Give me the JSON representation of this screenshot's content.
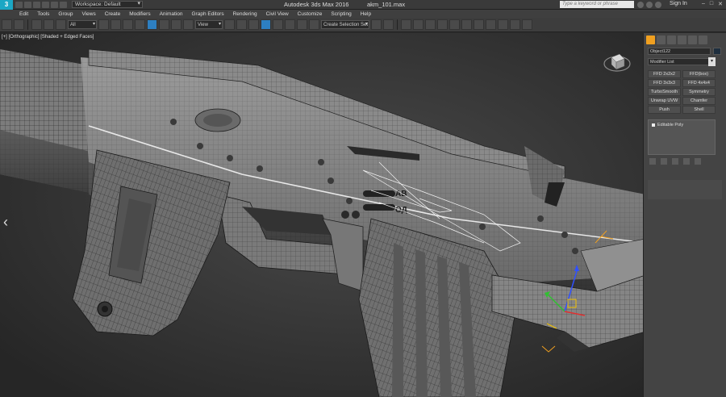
{
  "titlebar": {
    "app_logo": "3",
    "workspace": "Workspace: Default",
    "app_title": "Autodesk 3ds Max 2016",
    "file_name": "akm_101.max",
    "search_placeholder": "Type a keyword or phrase",
    "sign_in": "Sign In"
  },
  "menu": [
    "Edit",
    "Tools",
    "Group",
    "Views",
    "Create",
    "Modifiers",
    "Animation",
    "Graph Editors",
    "Rendering",
    "Civil View",
    "Customize",
    "Scripting",
    "Help"
  ],
  "toolbar": {
    "filter": "All",
    "ref_coord": "View",
    "named_selection": "Create Selection Set"
  },
  "viewport": {
    "label": "[+] [Orthographic] [Shaded + Edged Faces]",
    "engraving_top": "АВ",
    "engraving_bottom": "ОД"
  },
  "command_panel": {
    "object_name": "Object122",
    "modifier_list": "Modifier List",
    "modifier_buttons": [
      "FFD 2x2x2",
      "FFD(box)",
      "FFD 3x3x3",
      "FFD 4x4x4",
      "TurboSmooth",
      "Symmetry",
      "Unwrap UVW",
      "Chamfer",
      "Push",
      "Shell"
    ],
    "stack": [
      "Editable Poly"
    ]
  },
  "colors": {
    "accent": "#f0a020",
    "app_logo": "#1ba7c4",
    "selected_tool": "#2d7fc1",
    "gizmo_x": "#e03030",
    "gizmo_y": "#30c030",
    "gizmo_z": "#3050ff",
    "gizmo_pivot": "#f0c000"
  }
}
